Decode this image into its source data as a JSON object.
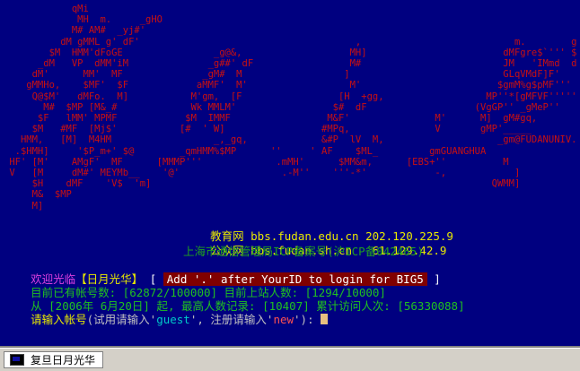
{
  "banner": {
    "art_lines": [
      "            qMi",
      "             MH  m.     _gHO",
      "            M# AM#  _yj#'",
      "          dM gMML g' dF'                                      ,                           m.        g    ,",
      "        $M  HMM'dFoGE                _g@&,                   MH]                        dMFgre$`''' $M",
      "      _dM   VP  dMM'iM              _g##' dF                 M#                         JM   'IMmd  dM",
      "     dM'      MM'  MF              _gM#  M                  ]                           GLqVMdF]F'",
      "    gMMHo,    $MF'  $F            aMMF'  M'                  M'                        $gmM%g$pMF'''",
      "     Q@$M'   dMFo.  M]           M'gm,  [F                 [H  +gg,                  MP''*[gMFVF'''''Y]",
      "       M#  $MP [M&_#             Wk MMLM'                 $#  dF                   (VgGP'' _gMeP''",
      "      $F   lMM' MPMF            $M  IMMF                 M&F'               M'      M]  gM#gq,",
      "     $M   #MF  [Mj$'           [#  ' W]                 #MPq,               V       gMP'_____",
      "   HMM,   [M]  M4HM                  _,_gq,             &#P  lV  M,                    _gm@FUDANUNIV.",
      "  .$HMH]     '$P_m+' $@        _qmHMM%$MP      ''     ' AF    $ML_         gmGUANGHUA",
      " HF' [M'    AMgF'  MF      [MMMP'''             .mMH'      $MM&m,      [EBS+''          M",
      " V   [M     dM#' MEYMb__    '@'                  .-M''    '''-*'            -,            ]",
      "     $H    dMF    'V$  'm]                                                            QWMM]",
      "     M&  $MP",
      "     M]"
    ],
    "hosts": [
      {
        "label": "教育网",
        "address": "bbs.fudan.edu.cn 202.120.225.9"
      },
      {
        "label": "公众网",
        "address": "bbs.fudan.sh.cn   61.129.42.9"
      }
    ],
    "icp": "上海市通信管理局ICP备案号(沪ICP备042465)"
  },
  "welcome": {
    "prefix": "欢迎光临",
    "bracket_open": "【",
    "site_name": "日月光华",
    "bracket_close": "】",
    "sq_open": "[",
    "notice": "Add '.' after YourID to login for BIG5",
    "sq_close": "]"
  },
  "stats": {
    "accounts_label": "目前已有帐号数:",
    "accounts_value": "[62872/100000]",
    "online_label": "目前上站人数:",
    "online_value": "[1294/10000]",
    "from_label": "从",
    "since_date": "[2006年 6月20日]",
    "record_label": "起, 最高人数记录:",
    "record_value": "[10407]",
    "visitors_label": "累计访问人次:",
    "visitors_value": "[56330088]"
  },
  "prompt": {
    "label": "请输入帐号",
    "hint_open": "(试用请输入'",
    "guest": "guest",
    "hint_mid": "', 注册请输入'",
    "new": "new",
    "hint_close": "'):"
  },
  "taskbar": {
    "tab_label": "复旦日月光华"
  }
}
